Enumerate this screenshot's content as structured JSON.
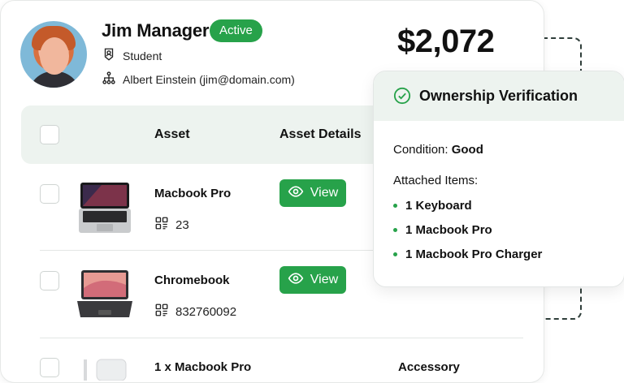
{
  "profile": {
    "name": "Jim Manager",
    "status": "Active",
    "role": "Student",
    "manager": "Albert Einstein (jim@domain.com)",
    "icons": {
      "role": "badge-user-icon",
      "manager": "org-chart-icon"
    }
  },
  "summary": {
    "amount": "$2,072"
  },
  "table": {
    "headers": {
      "asset": "Asset",
      "asset_details": "Asset Details"
    },
    "rows": [
      {
        "name": "Macbook Pro",
        "id": "23",
        "action": "View",
        "thumb": "laptop-macbook"
      },
      {
        "name": "Chromebook",
        "id": "832760092",
        "action": "View",
        "thumb": "laptop-chromebook"
      },
      {
        "name": "1 x Macbook Pro",
        "category": "Accessory",
        "thumb": "charger"
      }
    ]
  },
  "verification": {
    "title": "Ownership Verification",
    "condition_label": "Condition:",
    "condition_value": "Good",
    "attached_label": "Attached Items:",
    "items": [
      "1 Keyboard",
      "1 Macbook Pro",
      "1 Macbook Pro Charger"
    ]
  },
  "colors": {
    "accent": "#27a24a",
    "header_bg": "#edf3ef"
  }
}
